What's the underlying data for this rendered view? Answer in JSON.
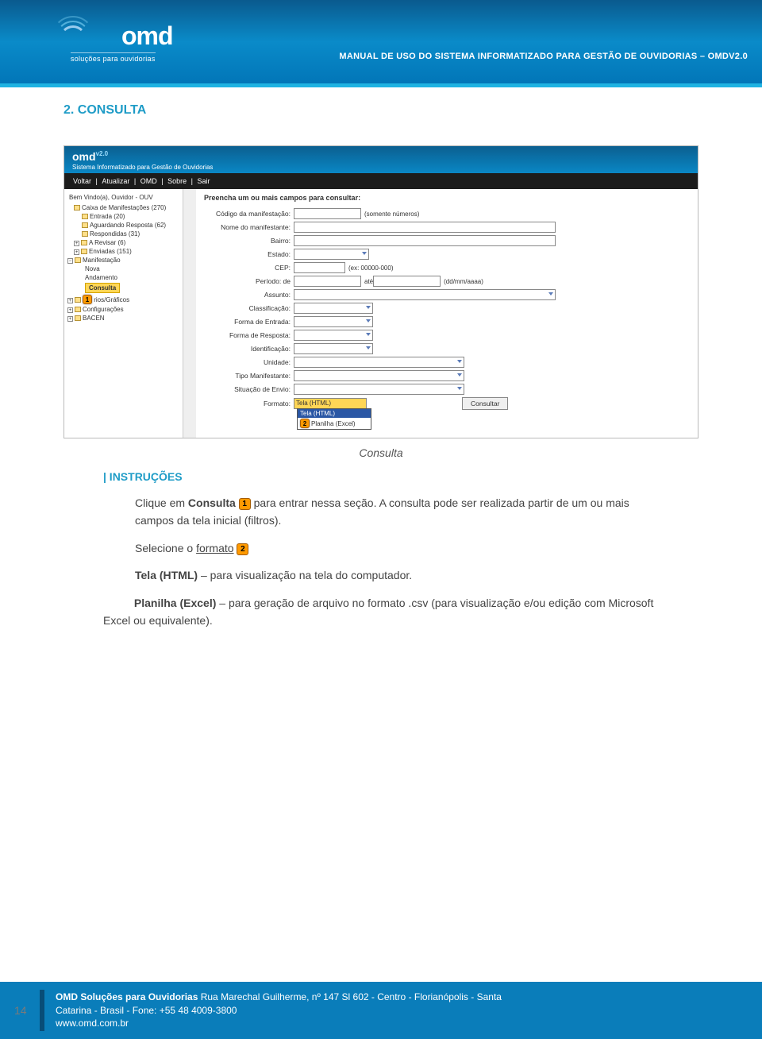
{
  "banner": {
    "logo_text": "omd",
    "logo_sub": "soluções para ouvidorias",
    "right_text": "MANUAL DE USO DO SISTEMA INFORMATIZADO PARA GESTÃO DE OUVIDORIAS – OMDV2.0"
  },
  "section_title": "2.  CONSULTA",
  "screenshot": {
    "app_logo": "omd",
    "app_v": "v2.0",
    "app_sub": "Sistema Informatizado para Gestão de Ouvidorias",
    "menu": [
      "Voltar",
      "Atualizar",
      "OMD",
      "Sobre",
      "Sair"
    ],
    "welcome": "Bem Vindo(a), Ouvidor - OUV",
    "tree": [
      "Caixa de Manifestações (270)",
      "Entrada (20)",
      "Aguardando Resposta (62)",
      "Respondidas (31)",
      "A Revisar (6)",
      "Enviadas (151)",
      "Manifestação",
      "Nova",
      "Andamento"
    ],
    "tree_highlight": "Consulta",
    "tree_after": [
      "rios/Gráficos",
      "Configurações",
      "BACEN"
    ],
    "form_header": "Preencha um ou mais campos para consultar:",
    "fields": {
      "codigo_lbl": "Código da manifestação:",
      "codigo_hint": "(somente números)",
      "nome_lbl": "Nome do manifestante:",
      "bairro_lbl": "Bairro:",
      "estado_lbl": "Estado:",
      "cep_lbl": "CEP:",
      "cep_hint": "(ex: 00000-000)",
      "periodo_lbl": "Período: de",
      "ate": "até",
      "periodo_hint": "(dd/mm/aaaa)",
      "assunto_lbl": "Assunto:",
      "classif_lbl": "Classificação:",
      "fentrada_lbl": "Forma de Entrada:",
      "fresposta_lbl": "Forma de Resposta:",
      "ident_lbl": "Identificação:",
      "unidade_lbl": "Unidade:",
      "tipomanif_lbl": "Tipo Manifestante:",
      "situacao_lbl": "Situação de Envio:",
      "formato_lbl": "Formato:",
      "formato_val": "Tela (HTML)",
      "formato_opts": [
        "Tela (HTML)",
        "Planilha (Excel)"
      ],
      "btn": "Consultar"
    },
    "callouts": {
      "c1": "1",
      "c2": "2"
    }
  },
  "caption": "Consulta",
  "instrucoes_h": "| INSTRUÇÕES",
  "instr": {
    "p1a": "Clique em ",
    "p1b": "Consulta",
    "p1c": " para entrar nessa seção. A consulta pode ser realizada partir de um ou mais campos da tela inicial (filtros).",
    "p2a": "Selecione o ",
    "p2b": "formato",
    "p3a": "Tela (HTML)",
    "p3b": " – para visualização na tela do computador.",
    "p4a": "Planilha (Excel)",
    "p4b": " – para geração de arquivo no formato .csv (para visualização e/ou edição com Microsoft Excel ou equivalente)."
  },
  "footer": {
    "page": "14",
    "l1a": "OMD Soluções para Ouvidorias ",
    "l1b": "Rua Marechal Guilherme, nº 147 Sl 602 - Centro - Florianópolis - Santa",
    "l2": "Catarina - Brasil - Fone: +55 48 4009-3800",
    "l3": "www.omd.com.br"
  }
}
